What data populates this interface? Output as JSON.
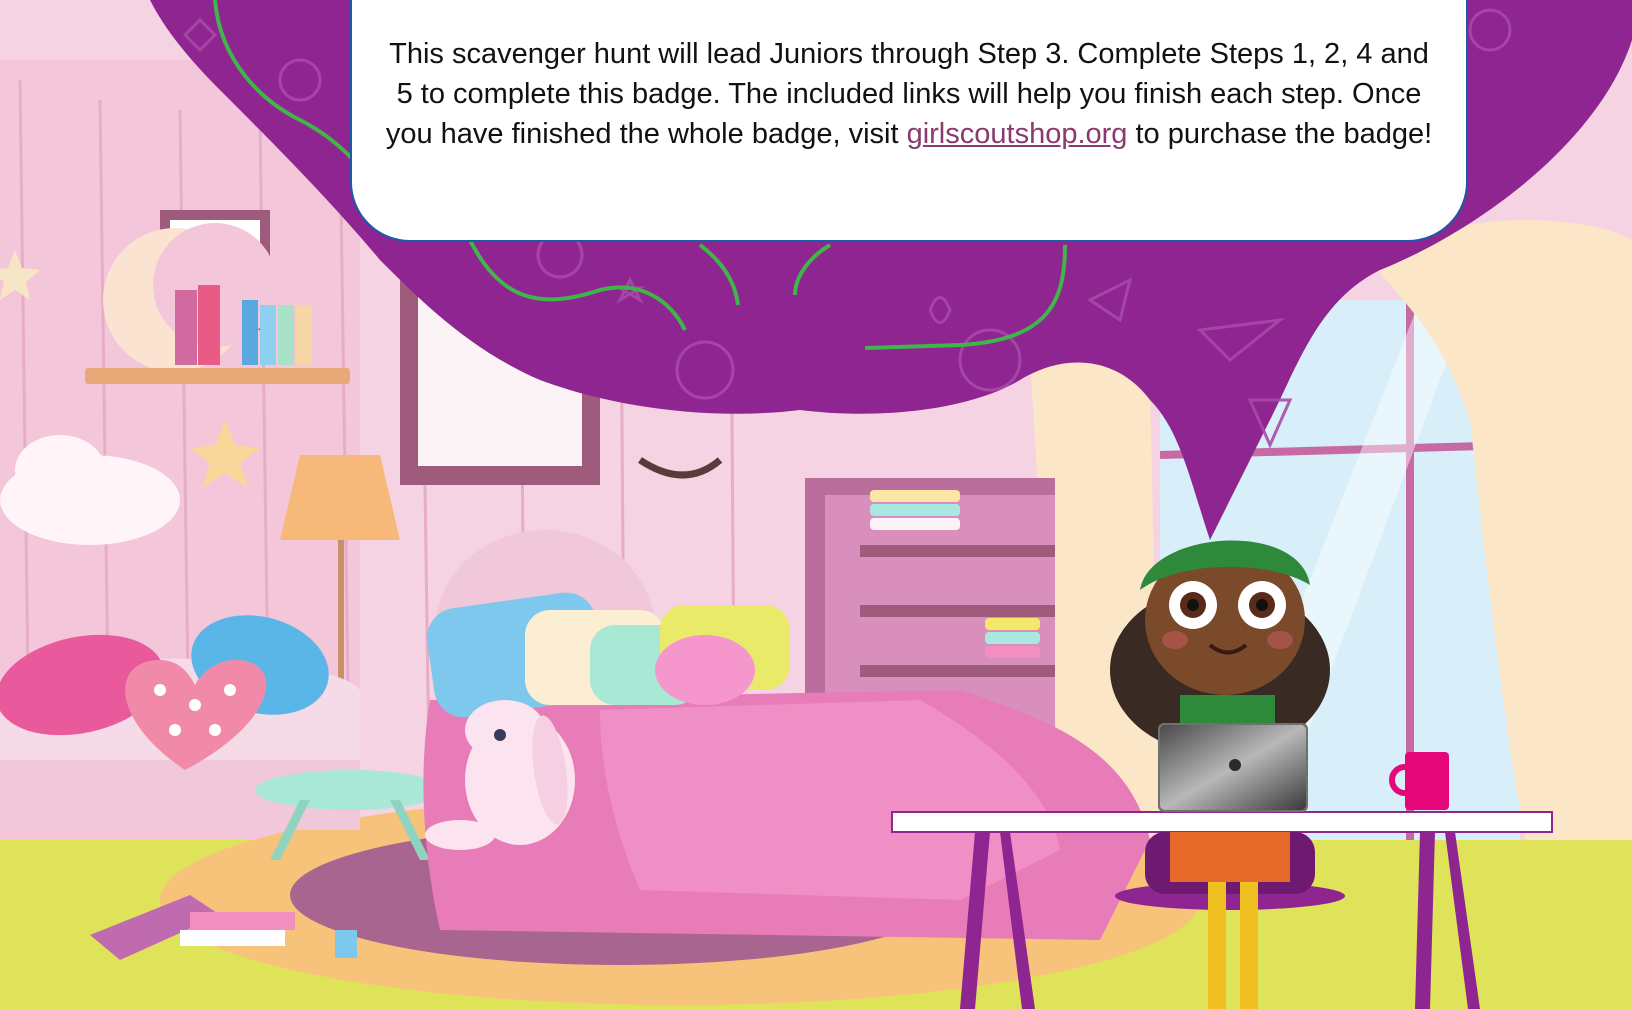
{
  "banner": {
    "text_before_link": "This scavenger hunt will lead Juniors through Step 3.  Complete Steps 1, 2, 4 and 5 to complete this badge.  The included links will help you finish each step.  Once you have finished the whole badge, visit ",
    "link_text": "girlscoutshop.org",
    "text_after_link": " to purchase the badge!"
  },
  "colors": {
    "wall": "#f6d3e2",
    "cloud_purple": "#8e2590",
    "floor": "#dfe35a",
    "bed_pink": "#e77cb8",
    "link": "#8a3a6e",
    "banner_border": "#1b5aa6"
  }
}
